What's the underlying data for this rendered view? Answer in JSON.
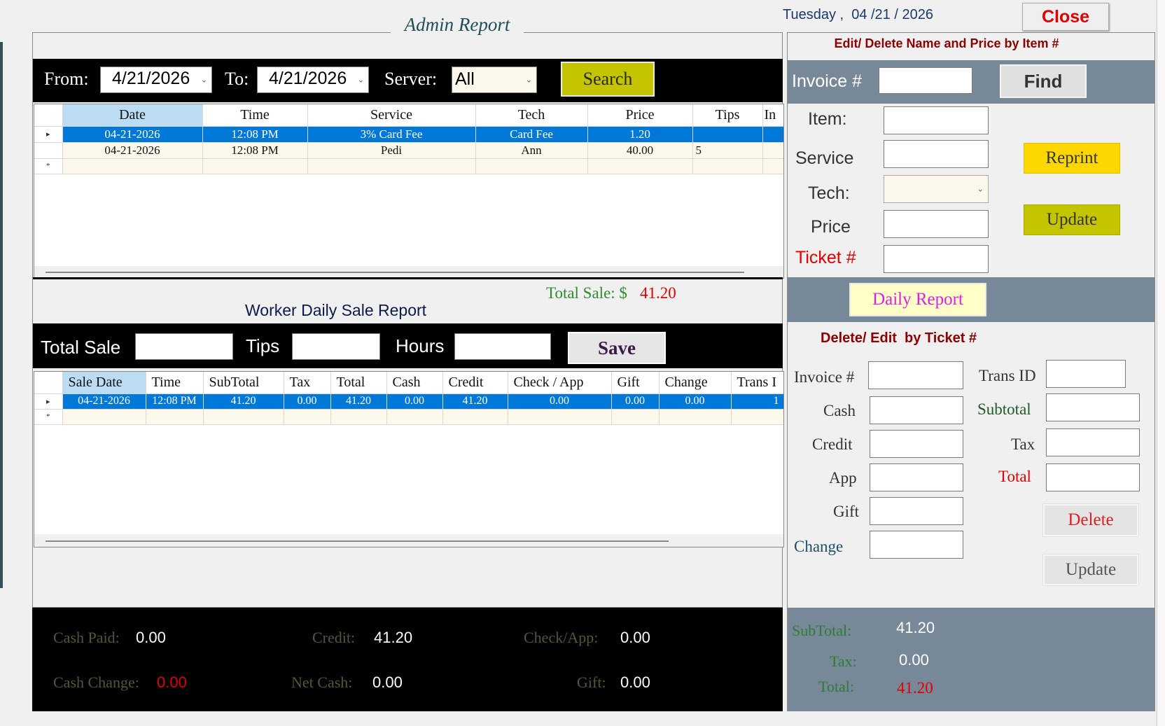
{
  "header": {
    "title": "Admin Report",
    "date_label": "Tuesday ,  04 /21 / 2026",
    "close_label": "Close"
  },
  "search_bar": {
    "from_label": "From:",
    "from_value": "4/21/2026",
    "to_label": "To:",
    "to_value": "4/21/2026",
    "server_label": "Server:",
    "server_value": "All",
    "search_label": "Search"
  },
  "items_grid": {
    "columns": [
      "Date",
      "Time",
      "Service",
      "Tech",
      "Price",
      "Tips",
      "In"
    ],
    "rows": [
      {
        "date": "04-21-2026",
        "time": "12:08 PM",
        "service": "3% Card Fee",
        "tech": "Card Fee",
        "price": "1.20",
        "tips": "",
        "in": ""
      },
      {
        "date": "04-21-2026",
        "time": "12:08 PM",
        "service": "Pedi",
        "tech": "Ann",
        "price": "40.00",
        "tips": "5",
        "in": ""
      }
    ],
    "new_row_marker": "*",
    "current_row_marker": "▸"
  },
  "total_sale": {
    "label": "Total Sale: $",
    "value": "41.20"
  },
  "worker_report": {
    "title": "Worker Daily Sale Report",
    "total_sale_label": "Total Sale",
    "tips_label": "Tips",
    "hours_label": "Hours",
    "save_label": "Save"
  },
  "sales_grid": {
    "columns": [
      "Sale Date",
      "Time",
      "SubTotal",
      "Tax",
      "Total",
      "Cash",
      "Credit",
      "Check / App",
      "Gift",
      "Change",
      "Trans I"
    ],
    "rows": [
      {
        "sale_date": "04-21-2026",
        "time": "12:08 PM",
        "subtotal": "41.20",
        "tax": "0.00",
        "total": "41.20",
        "cash": "0.00",
        "credit": "41.20",
        "check_app": "0.00",
        "gift": "0.00",
        "change": "0.00",
        "trans": "1"
      }
    ],
    "new_row_marker": "*",
    "current_row_marker": "▸"
  },
  "summary": {
    "cash_paid_label": "Cash Paid:",
    "cash_paid_value": "0.00",
    "credit_label": "Credit:",
    "credit_value": "41.20",
    "check_app_label": "Check/App:",
    "check_app_value": "0.00",
    "cash_change_label": "Cash Change:",
    "cash_change_value": "0.00",
    "net_cash_label": "Net Cash:",
    "net_cash_value": "0.00",
    "gift_label": "Gift:",
    "gift_value": "0.00"
  },
  "edit_item": {
    "title": "Edit/ Delete Name and Price by Item #",
    "invoice_label": "Invoice #",
    "find_label": "Find",
    "item_label": "Item:",
    "service_label": "Service",
    "tech_label": "Tech:",
    "price_label": "Price",
    "ticket_label": "Ticket #",
    "reprint_label": "Reprint",
    "update_label": "Update",
    "daily_report_label": "Daily Report"
  },
  "edit_ticket": {
    "title": "Delete/ Edit  by Ticket #",
    "invoice_label": "Invoice #",
    "cash_label": "Cash",
    "credit_label": "Credit",
    "app_label": "App",
    "gift_label": "Gift",
    "change_label": "Change",
    "trans_id_label": "Trans ID",
    "subtotal_label": "Subtotal",
    "tax_label": "Tax",
    "total_label": "Total",
    "delete_label": "Delete",
    "update_label": "Update"
  },
  "right_summary": {
    "subtotal_label": "SubTotal:",
    "subtotal_value": "41.20",
    "tax_label": "Tax:",
    "tax_value": "0.00",
    "total_label": "Total:",
    "total_value": "41.20"
  },
  "colors": {
    "accent_olive": "#c4c400",
    "reprint_yellow": "#ffd700",
    "panel_slate": "#778899",
    "selection_blue": "#0078d7",
    "red": "#e00000",
    "green_label": "#2e7d32"
  }
}
